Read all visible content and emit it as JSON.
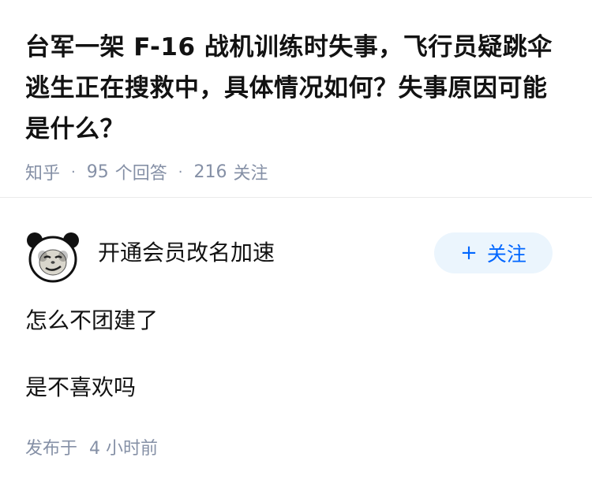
{
  "question": {
    "title": "台军一架 F-16 战机训练时失事，飞行员疑跳伞逃生正在搜救中，具体情况如何？失事原因可能是什么？",
    "source": "知乎",
    "separator": "·",
    "answer_count": "95",
    "answer_label": "个回答",
    "follower_count": "216",
    "follower_label": "关注"
  },
  "answer": {
    "author_name": "开通会员改名加速",
    "avatar_icon": "panda-meme-avatar-icon",
    "follow_plus": "+",
    "follow_label": "关注",
    "paragraphs": [
      "怎么不团建了",
      "是不喜欢吗"
    ],
    "published_label": "发布于",
    "published_time": "4 小时前"
  },
  "colors": {
    "text": "#121212",
    "meta": "#8590a6",
    "accent": "#0066ff",
    "button_bg": "#ebf5fd",
    "divider": "#ebebeb"
  }
}
